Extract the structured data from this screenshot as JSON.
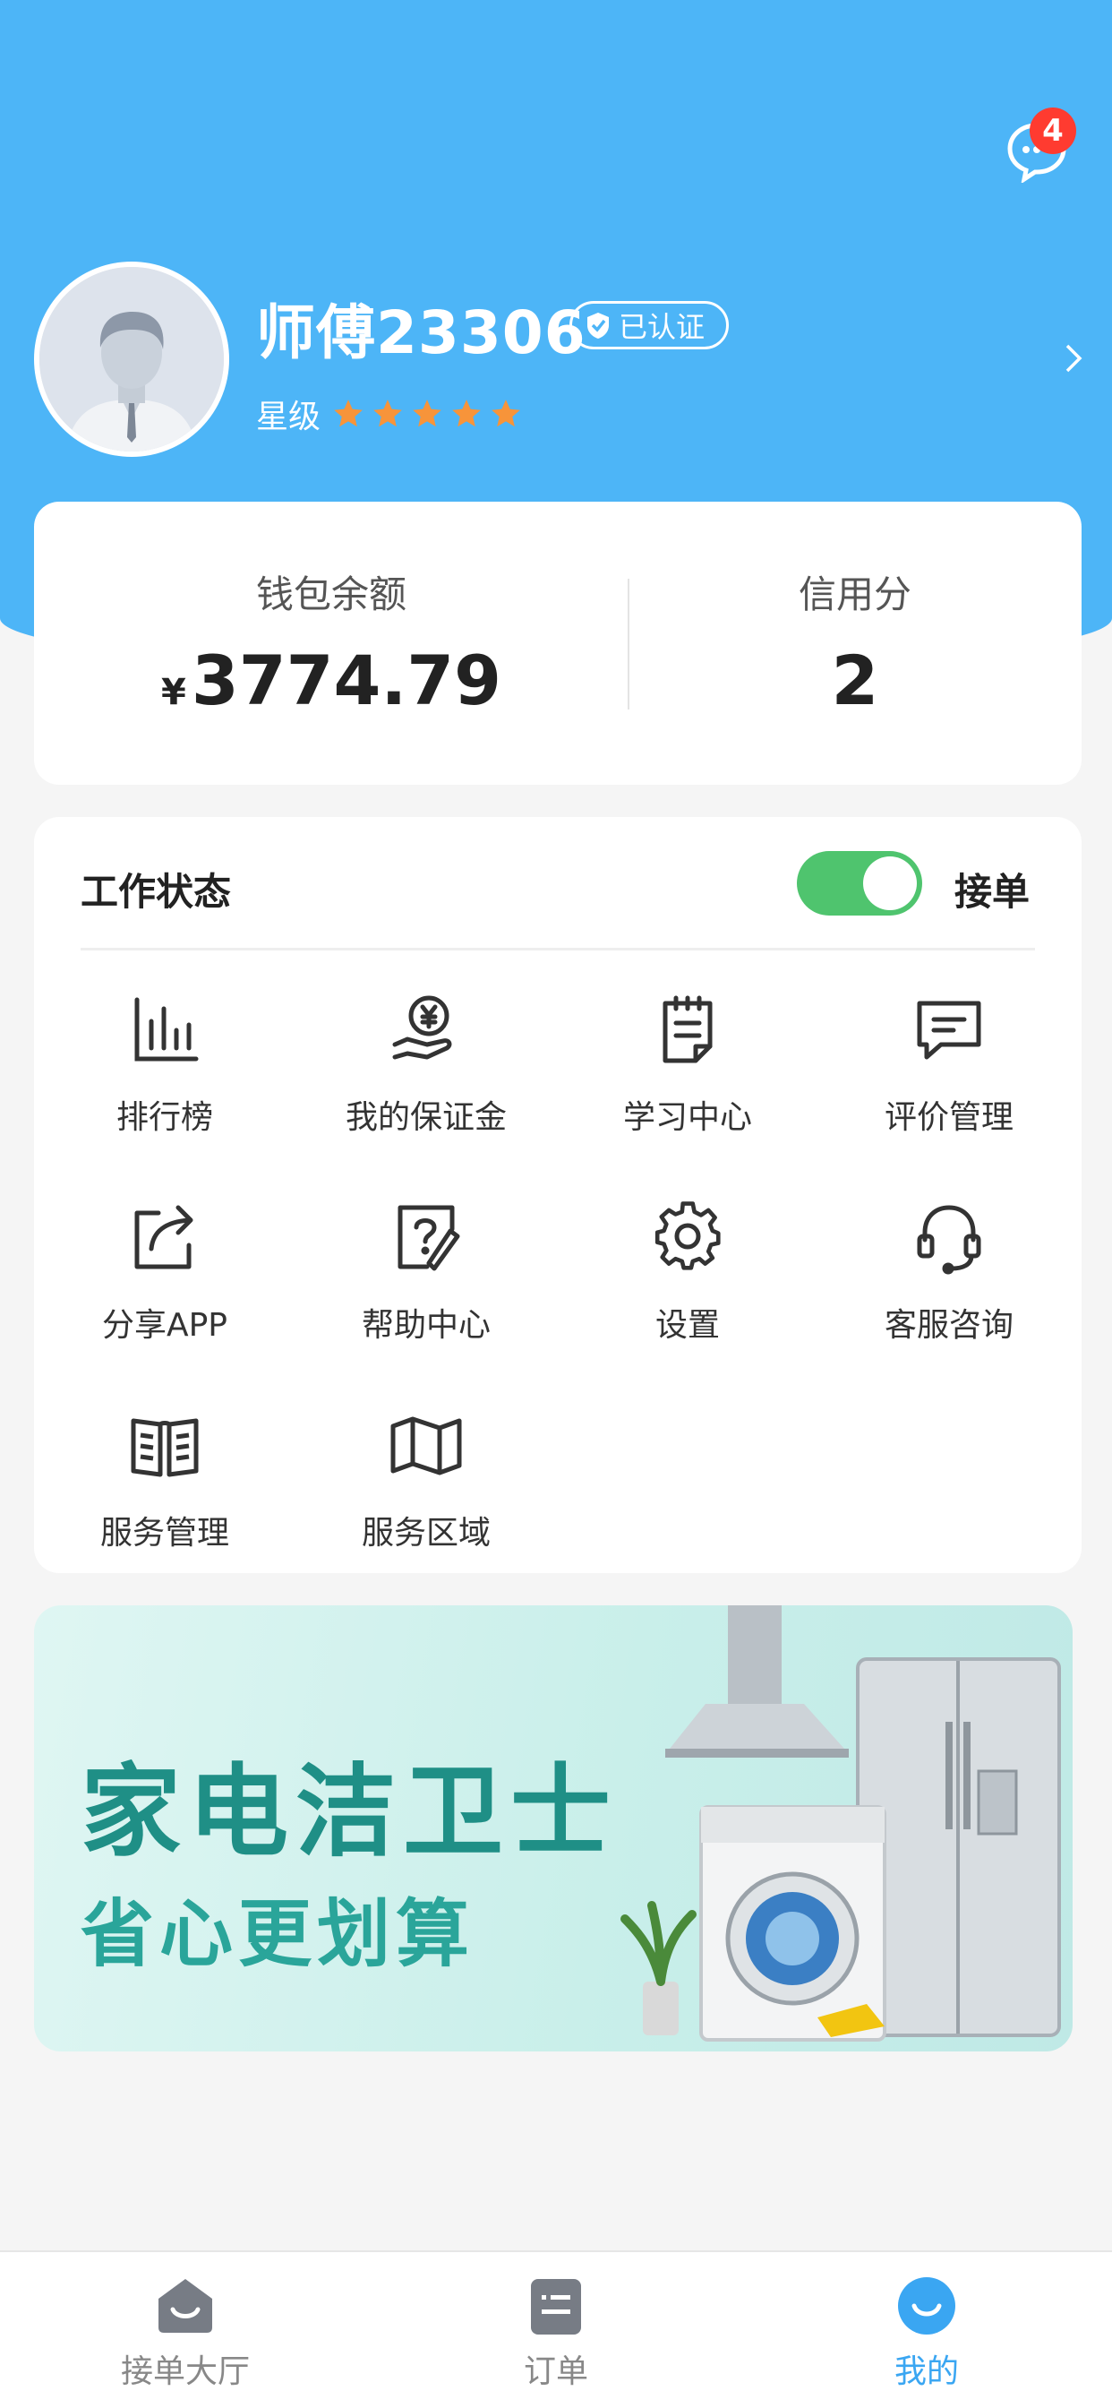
{
  "profile": {
    "username": "师傅23306",
    "verified_label": "已认证",
    "star_label": "星级",
    "star_rating": 5,
    "message_badge": "4"
  },
  "wallet": {
    "balance_label": "钱包余额",
    "currency_symbol": "¥",
    "balance_value": "3774.79",
    "credit_label": "信用分",
    "credit_value": "2"
  },
  "work_status": {
    "title": "工作状态",
    "toggle_on": true,
    "toggle_label": "接单"
  },
  "menu": [
    {
      "label": "排行榜",
      "icon": "bar-chart-icon"
    },
    {
      "label": "我的保证金",
      "icon": "deposit-icon"
    },
    {
      "label": "学习中心",
      "icon": "notebook-icon"
    },
    {
      "label": "评价管理",
      "icon": "comment-icon"
    },
    {
      "label": "分享APP",
      "icon": "share-icon"
    },
    {
      "label": "帮助中心",
      "icon": "help-icon"
    },
    {
      "label": "设置",
      "icon": "gear-icon"
    },
    {
      "label": "客服咨询",
      "icon": "headset-icon"
    },
    {
      "label": "服务管理",
      "icon": "book-icon"
    },
    {
      "label": "服务区域",
      "icon": "map-icon"
    }
  ],
  "banner": {
    "title": "家电洁卫士",
    "subtitle": "省心更划算"
  },
  "tabbar": {
    "items": [
      {
        "label": "接单大厅",
        "icon": "hall-icon",
        "active": false
      },
      {
        "label": "订单",
        "icon": "order-icon",
        "active": false
      },
      {
        "label": "我的",
        "icon": "me-icon",
        "active": true
      }
    ]
  },
  "colors": {
    "header_blue": "#4db5f7",
    "toggle_green": "#4fc46e",
    "star_orange": "#f7943a",
    "tab_active": "#3aa6f2",
    "banner_teal": "#1f8f86"
  }
}
